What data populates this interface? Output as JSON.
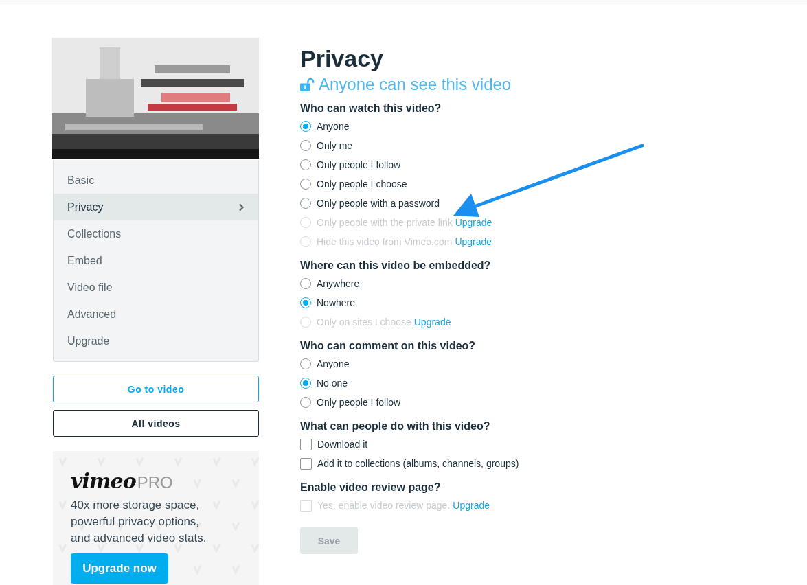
{
  "sidebar": {
    "items": [
      {
        "label": "Basic",
        "selected": false
      },
      {
        "label": "Privacy",
        "selected": true
      },
      {
        "label": "Collections",
        "selected": false
      },
      {
        "label": "Embed",
        "selected": false
      },
      {
        "label": "Video file",
        "selected": false
      },
      {
        "label": "Advanced",
        "selected": false
      },
      {
        "label": "Upgrade",
        "selected": false
      }
    ],
    "buttons": [
      {
        "label": "Go to video",
        "kind": "primary"
      },
      {
        "label": "All videos",
        "kind": "secondary"
      }
    ],
    "promo": {
      "logo": "vimeo",
      "logo_suffix": "PRO",
      "text": "40x more storage space, powerful privacy options, and advanced video stats.",
      "button": "Upgrade now"
    }
  },
  "main": {
    "title": "Privacy",
    "status": "Anyone can see this video",
    "sections": [
      {
        "heading": "Who can watch this video?",
        "kind": "radio",
        "options": [
          {
            "label": "Anyone",
            "selected": true,
            "disabled": false
          },
          {
            "label": "Only me",
            "selected": false,
            "disabled": false
          },
          {
            "label": "Only people I follow",
            "selected": false,
            "disabled": false
          },
          {
            "label": "Only people I choose",
            "selected": false,
            "disabled": false
          },
          {
            "label": "Only people with a password",
            "selected": false,
            "disabled": false
          },
          {
            "label": "Only people with the private link",
            "selected": false,
            "disabled": true,
            "link": "Upgrade"
          },
          {
            "label": "Hide this video from Vimeo.com",
            "selected": false,
            "disabled": true,
            "link": "Upgrade"
          }
        ]
      },
      {
        "heading": "Where can this video be embedded?",
        "kind": "radio",
        "options": [
          {
            "label": "Anywhere",
            "selected": false,
            "disabled": false
          },
          {
            "label": "Nowhere",
            "selected": true,
            "disabled": false
          },
          {
            "label": "Only on sites I choose",
            "selected": false,
            "disabled": true,
            "link": "Upgrade"
          }
        ]
      },
      {
        "heading": "Who can comment on this video?",
        "kind": "radio",
        "options": [
          {
            "label": "Anyone",
            "selected": false,
            "disabled": false
          },
          {
            "label": "No one",
            "selected": true,
            "disabled": false
          },
          {
            "label": "Only people I follow",
            "selected": false,
            "disabled": false
          }
        ]
      },
      {
        "heading": "What can people do with this video?",
        "kind": "checkbox",
        "options": [
          {
            "label": "Download it",
            "selected": false,
            "disabled": false
          },
          {
            "label": "Add it to collections (albums, channels, groups)",
            "selected": false,
            "disabled": false
          }
        ]
      },
      {
        "heading": "Enable video review page?",
        "kind": "checkbox",
        "options": [
          {
            "label": "Yes, enable video review page.",
            "selected": false,
            "disabled": true,
            "link": "Upgrade"
          }
        ]
      }
    ],
    "save": {
      "label": "Save",
      "disabled": true
    }
  }
}
